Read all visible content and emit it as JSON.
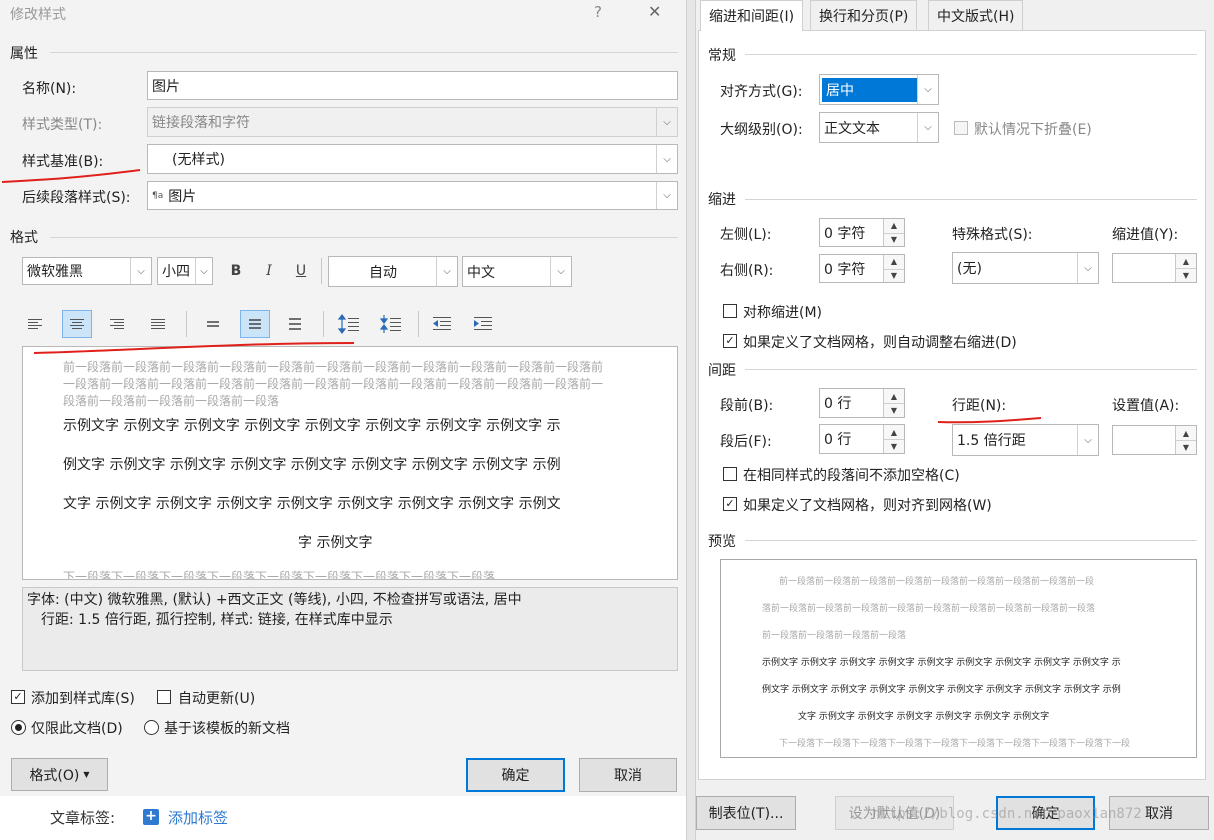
{
  "left": {
    "title": "修改样式",
    "help": "?",
    "close": "✕",
    "props_group": "属性",
    "name_label": "名称(N):",
    "name_value": "图片",
    "type_label": "样式类型(T):",
    "type_value": "链接段落和字符",
    "base_label": "样式基准(B):",
    "base_value": "(无样式)",
    "next_label": "后续段落样式(S):",
    "next_icon": "¶a",
    "next_value": "图片",
    "format_group": "格式",
    "font": "微软雅黑",
    "size": "小四",
    "bold": "B",
    "italic": "I",
    "underline": "U",
    "color": "自动",
    "script": "中文",
    "prev_para": "前一段落前一段落前一段落前一段落前一段落前一段落前一段落前一段落前一段落前一段落前一段落前一段落前一段落前一段落前一段落前一段落前一段落前一段落前一段落前一段落前一段落前一段落前一段落前一段落前一段落前一段落前一段落",
    "sample_lines": [
      "示例文字 示例文字 示例文字 示例文字 示例文字 示例文字 示例文字 示例文字 示",
      "例文字 示例文字 示例文字 示例文字 示例文字 示例文字 示例文字 示例文字 示例",
      "文字 示例文字 示例文字 示例文字 示例文字 示例文字 示例文字 示例文字 示例文",
      "字 示例文字"
    ],
    "next_para": "下一段落下一段落下一段落下一段落下一段落下一段落下一段落下一段落下一段落",
    "desc_line1": "字体: (中文) 微软雅黑, (默认) +西文正文 (等线), 小四, 不检查拼写或语法, 居中",
    "desc_line2": "行距: 1.5 倍行距, 孤行控制, 样式: 链接, 在样式库中显示",
    "add_gallery": "添加到样式库(S)",
    "auto_update": "自动更新(U)",
    "only_doc": "仅限此文档(D)",
    "new_docs": "基于该模板的新文档",
    "format_btn": "格式(O)",
    "ok": "确定",
    "cancel": "取消",
    "bottom_label": "文章标签:",
    "add_tag": "添加标签"
  },
  "right": {
    "tabs": [
      "缩进和间距(I)",
      "换行和分页(P)",
      "中文版式(H)"
    ],
    "general": "常规",
    "align_label": "对齐方式(G):",
    "align_value": "居中",
    "outline_label": "大纲级别(O):",
    "outline_value": "正文文本",
    "collapse": "默认情况下折叠(E)",
    "indent": "缩进",
    "left_label": "左侧(L):",
    "left_value": "0 字符",
    "right_label": "右侧(R):",
    "right_value": "0 字符",
    "special_label": "特殊格式(S):",
    "special_value": "(无)",
    "indent_by": "缩进值(Y):",
    "mirror": "对称缩进(M)",
    "auto_indent": "如果定义了文档网格，则自动调整右缩进(D)",
    "spacing": "间距",
    "before_label": "段前(B):",
    "before_value": "0 行",
    "after_label": "段后(F):",
    "after_value": "0 行",
    "ls_label": "行距(N):",
    "ls_value": "1.5 倍行距",
    "at_label": "设置值(A):",
    "no_space": "在相同样式的段落间不添加空格(C)",
    "snap_grid": "如果定义了文档网格，则对齐到网格(W)",
    "preview": "预览",
    "pv_prev1": "前一段落前一段落前一段落前一段落前一段落前一段落前一段落前一段落前一段",
    "pv_prev2": "落前一段落前一段落前一段落前一段落前一段落前一段落前一段落前一段落前一段落",
    "pv_prev3": "前一段落前一段落前一段落前一段落",
    "pv_s1": "示例文字 示例文字 示例文字 示例文字 示例文字 示例文字 示例文字 示例文字 示例文字 示",
    "pv_s2": "例文字 示例文字 示例文字 示例文字 示例文字 示例文字 示例文字 示例文字 示例文字 示例",
    "pv_s3": "文字 示例文字 示例文字 示例文字 示例文字 示例文字 示例文字",
    "pv_next": "下一段落下一段落下一段落下一段落下一段落下一段落下一段落下一段落下一段落下一段",
    "tabs_btn": "制表位(T)...",
    "default_btn": "设为默认值(D)",
    "ok": "确定",
    "cancel": "取消",
    "watermark": "https://blog.csdn.net/paox1an872"
  }
}
